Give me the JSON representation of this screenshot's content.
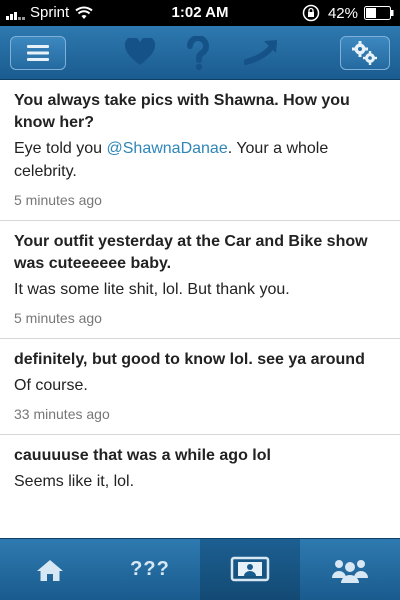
{
  "status_bar": {
    "carrier": "Sprint",
    "time": "1:02 AM",
    "battery": "42%"
  },
  "top_bar": {
    "icons": [
      "menu-icon",
      "heart-icon",
      "question-mark-icon",
      "reply-arrow-icon",
      "gear-icon"
    ]
  },
  "posts": [
    {
      "question": "You always take pics with Shawna. How you know her?",
      "answer_before": "Eye told you ",
      "mention": "@ShawnaDanae",
      "answer_after": ". Your a whole celebrity.",
      "time": "5 minutes ago"
    },
    {
      "question": "Your outfit yesterday at the Car and Bike show was cuteeeeee baby.",
      "answer": "It was some lite shit, lol. But thank you.",
      "time": "5 minutes ago"
    },
    {
      "question": "definitely, but good to know lol. see ya around",
      "answer": "Of course.",
      "time": "33 minutes ago"
    },
    {
      "question": "cauuuuse that was a while ago lol",
      "answer": "Seems like it, lol."
    }
  ],
  "tab_bar": {
    "tabs": [
      {
        "icon": "home-icon"
      },
      {
        "label": "???"
      },
      {
        "icon": "profile-card-icon",
        "active": true
      },
      {
        "icon": "people-icon"
      }
    ]
  },
  "colors": {
    "bar_blue": "#2d79b0",
    "mention_blue": "#2f86b8"
  }
}
